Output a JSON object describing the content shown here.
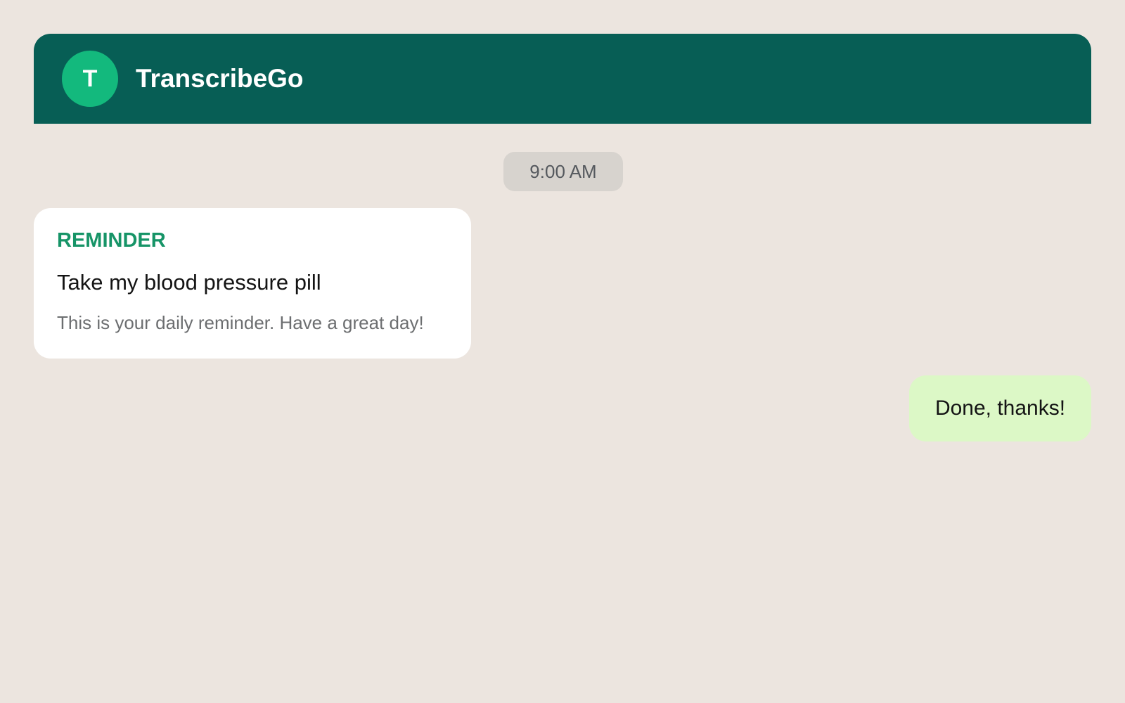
{
  "header": {
    "avatar_initial": "T",
    "contact_name": "TranscribeGo"
  },
  "chat": {
    "timestamp": "9:00 AM",
    "messages": [
      {
        "direction": "incoming",
        "tag": "REMINDER",
        "title": "Take my blood pressure pill",
        "body": "This is your daily reminder. Have a great day!"
      },
      {
        "direction": "outgoing",
        "text": "Done, thanks!"
      }
    ]
  },
  "colors": {
    "background": "#ece5df",
    "header": "#075e55",
    "avatar": "#13b97d",
    "accent": "#169467",
    "incoming_bubble": "#ffffff",
    "outgoing_bubble": "#dcf8c6",
    "timestamp_pill": "#d7d3ce"
  }
}
